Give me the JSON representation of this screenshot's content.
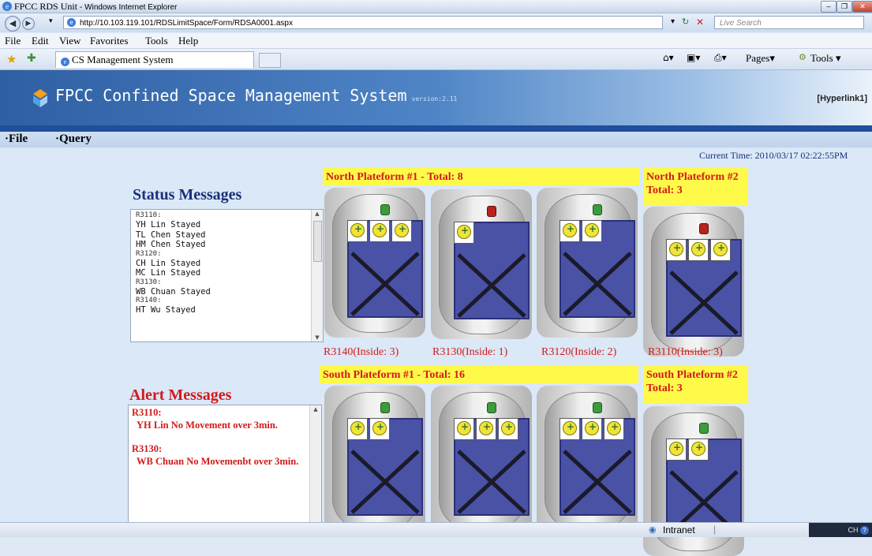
{
  "window": {
    "title": "FPCC RDS Unit",
    "title_suffix": "- Windows Internet Explorer"
  },
  "address": {
    "url": "http://10.103.119.101/RDSLimitSpace/Form/RDSA0001.aspx",
    "search_placeholder": "Live Search"
  },
  "menu": [
    "File",
    "Edit",
    "View",
    "Favorites",
    "Tools",
    "Help"
  ],
  "tab": {
    "label": "CS Management System"
  },
  "toolbar": {
    "pages": "Pages",
    "tools": "Tools"
  },
  "banner": {
    "title": "FPCC Confined Space Management System",
    "version": "version:2.11",
    "hyperlink": "[Hyperlink1]"
  },
  "nav": {
    "file": "·File",
    "query": "·Query"
  },
  "current_time": "Current Time: 2010/03/17 02:22:55PM",
  "status": {
    "heading": "Status Messages",
    "lines": [
      {
        "unit": "R3110:",
        "names": [
          "YH Lin Stayed",
          "TL Chen Stayed",
          "HM Chen Stayed"
        ]
      },
      {
        "unit": "R3120:",
        "names": [
          "CH Lin Stayed",
          "MC Lin Stayed"
        ]
      },
      {
        "unit": "R3130:",
        "names": [
          "WB Chuan Stayed"
        ]
      },
      {
        "unit": "R3140:",
        "names": [
          "HT Wu Stayed"
        ]
      }
    ]
  },
  "alerts": {
    "heading": "Alert Messages",
    "items": [
      {
        "unit": "R3110:",
        "text": "YH Lin No Movement over 3min."
      },
      {
        "unit": "R3130:",
        "text": "WB Chuan No Movemenbt over 3min."
      }
    ]
  },
  "platforms": {
    "north1": "North Plateform #1 - Total: 8",
    "north2": "North Plateform #2 Total: 3",
    "south1": "South Plateform #1 - Total: 16",
    "south2": "South Plateform #2 Total: 3"
  },
  "units_north": [
    {
      "label": "R3140(Inside: 3)",
      "workers": 3,
      "lamp": "green"
    },
    {
      "label": "R3130(Inside: 1)",
      "workers": 1,
      "lamp": "red"
    },
    {
      "label": "R3120(Inside: 2)",
      "workers": 2,
      "lamp": "green"
    },
    {
      "label": "R3110(Inside: 3)",
      "workers": 3,
      "lamp": "red"
    }
  ],
  "units_south": [
    {
      "workers": 2,
      "lamp": "green"
    },
    {
      "workers": 3,
      "lamp": "green"
    },
    {
      "workers": 3,
      "lamp": "green"
    },
    {
      "workers": 2,
      "lamp": "green"
    }
  ],
  "statusbar": {
    "zone": "Intranet",
    "tray": "CH"
  }
}
